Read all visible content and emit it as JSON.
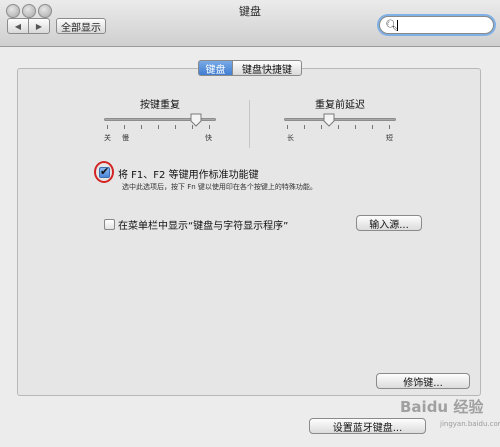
{
  "window": {
    "title": "键盘"
  },
  "toolbar": {
    "back_icon": "chevron-left-icon",
    "forward_icon": "chevron-right-icon",
    "show_all_label": "全部显示",
    "search_placeholder": ""
  },
  "tabs": [
    {
      "label": "键盘",
      "selected": true
    },
    {
      "label": "键盘快捷键",
      "selected": false
    }
  ],
  "sliders": {
    "key_repeat": {
      "label": "按键重复",
      "min_labels": [
        "关",
        "慢"
      ],
      "max_label": "快",
      "value": 0.9
    },
    "delay_until_repeat": {
      "label": "重复前延迟",
      "min_label": "长",
      "max_label": "短",
      "value": 0.35
    }
  },
  "fn_option": {
    "checked": true,
    "label": "将 F1、F2 等键用作标准功能键",
    "description": "选中此选项后，按下 Fn 键以使用印在各个按键上的特殊功能。"
  },
  "menu_bar_option": {
    "checked": false,
    "label": "在菜单栏中显示“键盘与字符显示程序”"
  },
  "buttons": {
    "input_sources": "输入源...",
    "modifier_keys": "修饰键...",
    "setup_bluetooth": "设置蓝牙键盘..."
  },
  "watermark": {
    "text": "Baidu 经验",
    "sub": "jingyan.baidu.com"
  },
  "colors": {
    "accent": "#3f7dd2",
    "annotation": "#d32424"
  }
}
